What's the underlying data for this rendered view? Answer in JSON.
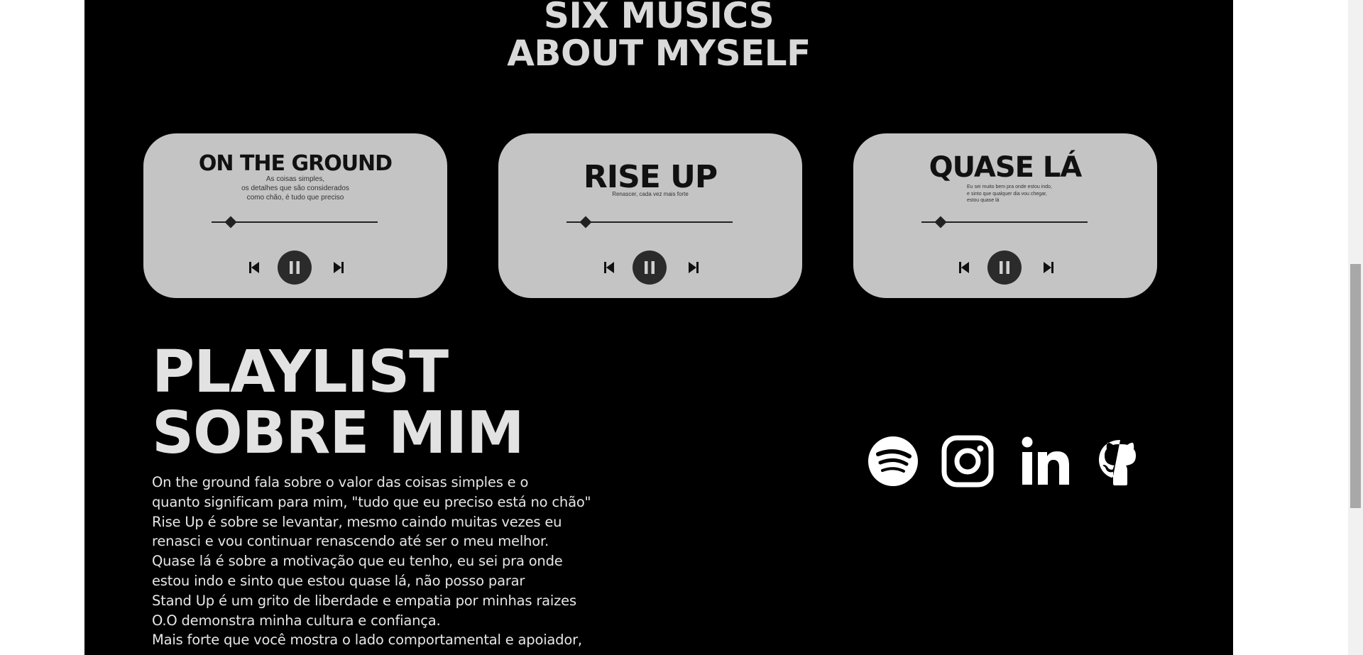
{
  "header": {
    "line1": "SIX MUSICS",
    "line2": "ABOUT MYSELF"
  },
  "players": [
    {
      "title": "ON THE GROUND",
      "description": "As coisas simples,\nos detalhes que são considerados\ncomo chão, é tudo que preciso",
      "progress": 0.12,
      "controls": [
        "skip-back-icon",
        "pause-icon",
        "skip-forward-icon"
      ]
    },
    {
      "title": "RISE UP",
      "description": "Renascer, cada vez mais forte",
      "progress": 0.12,
      "controls": [
        "skip-back-icon",
        "pause-icon",
        "skip-forward-icon"
      ]
    },
    {
      "title": "QUASE LÁ",
      "description": "Eu sei muito bem pra onde estou indo,\ne sinto que qualquer dia vou chegar,\nestou quase lá",
      "progress": 0.12,
      "controls": [
        "skip-back-icon",
        "pause-icon",
        "skip-forward-icon"
      ]
    }
  ],
  "playlist": {
    "title_line1": "PLAYLIST",
    "title_line2": "SOBRE MIM",
    "lines": [
      " On the ground fala sobre o valor das coisas simples e o",
      "quanto significam para mim, \"tudo que eu preciso está no chão\"",
      "Rise Up é sobre se levantar, mesmo caindo muitas vezes eu",
      "renasci e vou continuar renascendo até ser o meu melhor.",
      "Quase lá é sobre a motivação que eu tenho, eu sei pra onde",
      "estou indo e sinto que estou quase lá, não posso parar",
      "Stand Up é um grito de liberdade e empatia por minhas raizes",
      "O.O demonstra minha cultura e confiança.",
      "Mais forte que você  mostra o lado comportamental e apoiador,"
    ]
  },
  "social": [
    "spotify-icon",
    "instagram-icon",
    "linkedin-icon",
    "github-icon"
  ],
  "colors": {
    "page_background": "#000000",
    "card_background": "#c4c4c4",
    "heading_text": "#d9d9d9",
    "body_text": "#e6e6e6",
    "dark_ink": "#222222"
  }
}
